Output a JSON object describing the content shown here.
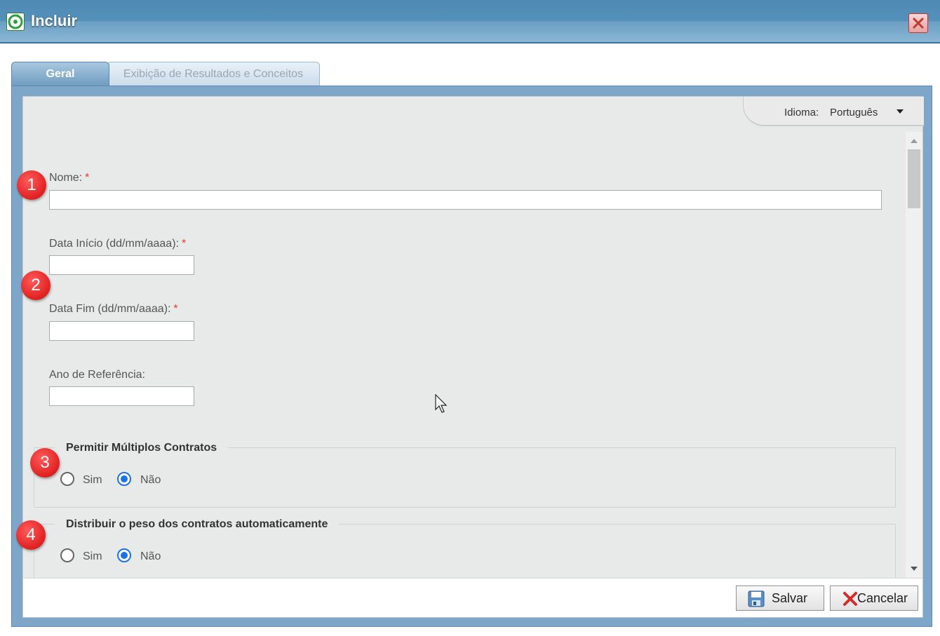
{
  "window": {
    "title": "Incluir",
    "app_icon": "refresh-icon",
    "close_icon": "close-icon"
  },
  "tabs": [
    {
      "label": "Geral",
      "active": true
    },
    {
      "label": "Exibição de Resultados e Conceitos",
      "active": false
    }
  ],
  "language": {
    "label": "Idioma:",
    "value": "Português"
  },
  "form": {
    "nome": {
      "label": "Nome:",
      "required": "*",
      "value": ""
    },
    "data_inicio": {
      "label": "Data Início (dd/mm/aaaa):",
      "required": "*",
      "value": ""
    },
    "data_fim": {
      "label": "Data Fim (dd/mm/aaaa):",
      "required": "*",
      "value": ""
    },
    "ano_referencia": {
      "label": "Ano de Referência:",
      "value": ""
    },
    "multiplos_contratos": {
      "legend": "Permitir Múltiplos Contratos",
      "options": [
        "Sim",
        "Não"
      ],
      "selected": "Não"
    },
    "distribuir_peso": {
      "legend": "Distribuir o peso dos contratos automaticamente",
      "options": [
        "Sim",
        "Não"
      ],
      "selected": "Não"
    }
  },
  "markers": [
    "1",
    "2",
    "3",
    "4"
  ],
  "buttons": {
    "save": {
      "label": "Salvar",
      "icon": "floppy-disk-icon"
    },
    "cancel": {
      "label": "Cancelar",
      "icon": "red-x-icon"
    }
  },
  "colors": {
    "titlebar": "#5390ba",
    "accent_radio": "#1a73e8",
    "required": "#e53935",
    "marker": "#e02020"
  }
}
